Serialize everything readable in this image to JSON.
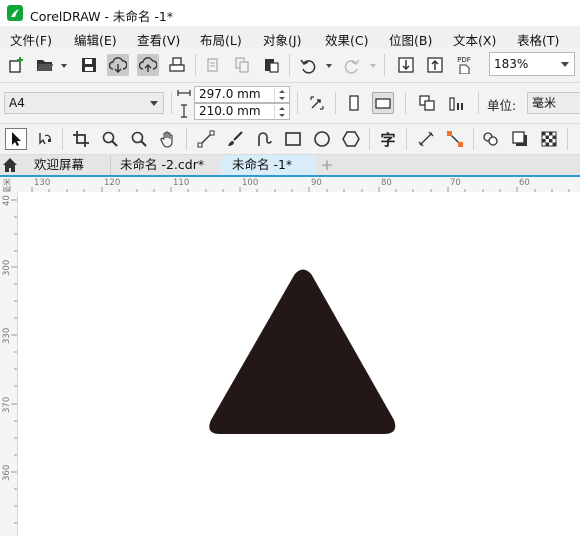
{
  "window": {
    "title": "CorelDRAW - 未命名 -1*"
  },
  "menu": [
    "文件(F)",
    "编辑(E)",
    "查看(V)",
    "布局(L)",
    "对象(J)",
    "效果(C)",
    "位图(B)",
    "文本(X)",
    "表格(T)"
  ],
  "standard_toolbar": {
    "pdf_label": "PDF",
    "zoom_value": "183%"
  },
  "property_bar": {
    "page_size": "A4",
    "page_width": "297.0 mm",
    "page_height": "210.0 mm",
    "units_label": "单位:",
    "units_value": "毫米"
  },
  "toolbox": {
    "text_tool_glyph": "字"
  },
  "tabs": [
    {
      "label": "欢迎屏幕",
      "active": false
    },
    {
      "label": "未命名 -2.cdr*",
      "active": false
    },
    {
      "label": "未命名 -1*",
      "active": true
    }
  ],
  "add_tab_glyph": "+",
  "rulers": {
    "unit_label": "毫米",
    "horizontal_ticks": [
      "130",
      "120",
      "110",
      "100",
      "90",
      "80",
      "70",
      "60"
    ],
    "vertical_ticks": [
      "40",
      "300",
      "330",
      "370",
      "360"
    ]
  },
  "canvas": {
    "shape": "rounded-triangle",
    "shape_fill": "#231815"
  },
  "colors": {
    "accent": "#2e9ad8",
    "logo": "#0ea63b",
    "active_tab": "#d8ecfa"
  }
}
